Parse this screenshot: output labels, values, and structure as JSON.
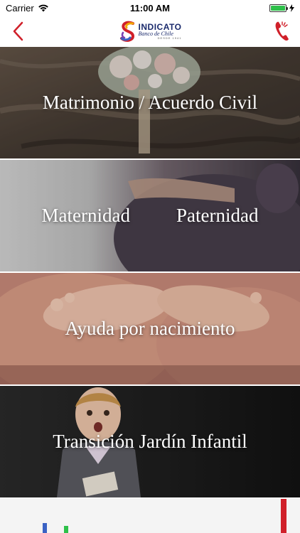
{
  "status_bar": {
    "carrier": "Carrier",
    "time": "11:00 AM"
  },
  "nav": {
    "logo_title": "INDICATO",
    "logo_subtitle": "Banco de Chile",
    "logo_tiny": "DESDE 1941"
  },
  "cards": [
    {
      "title": "Matrimonio / Acuerdo Civil"
    },
    {
      "left_title": "Maternidad",
      "right_title": "Paternidad"
    },
    {
      "title": "Ayuda por nacimiento"
    },
    {
      "title": "Transición Jardín Infantil"
    }
  ],
  "colors": {
    "accent_red": "#d0202a",
    "logo_navy": "#1a2a6c",
    "battery_green": "#2ec04a"
  }
}
